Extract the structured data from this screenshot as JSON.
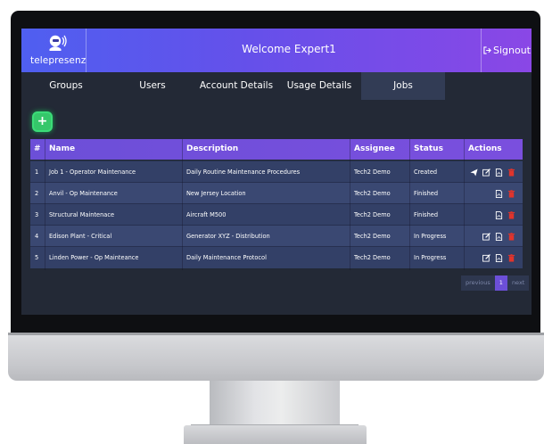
{
  "app": {
    "logo_text": "telepresenz",
    "welcome": "Welcome Expert1",
    "signout_label": "Signout"
  },
  "tabs": [
    {
      "label": "Groups",
      "active": false
    },
    {
      "label": "Users",
      "active": false
    },
    {
      "label": "Account Details",
      "active": false
    },
    {
      "label": "Usage Details",
      "active": false
    },
    {
      "label": "Jobs",
      "active": true
    }
  ],
  "add_button": {
    "label": "+"
  },
  "table": {
    "headers": [
      "#",
      "Name",
      "Description",
      "Assignee",
      "Status",
      "Actions"
    ],
    "rows": [
      {
        "num": "1",
        "name": "Job 1 - Operator Maintenance",
        "description": "Daily Routine Maintenance Procedures",
        "assignee": "Tech2 Demo",
        "status": "Created",
        "actions": [
          "send-icon",
          "edit-icon",
          "pdf-icon",
          "trash-icon"
        ]
      },
      {
        "num": "2",
        "name": "Anvil - Op Maintenance",
        "description": "New Jersey Location",
        "assignee": "Tech2 Demo",
        "status": "Finished",
        "actions": [
          "pdf-icon",
          "trash-icon"
        ]
      },
      {
        "num": "3",
        "name": "Structural Maintenace",
        "description": "Aircraft M500",
        "assignee": "Tech2 Demo",
        "status": "Finished",
        "actions": [
          "pdf-icon",
          "trash-icon"
        ]
      },
      {
        "num": "4",
        "name": "Edison Plant - Critical",
        "description": "Generator XYZ - Distribution",
        "assignee": "Tech2 Demo",
        "status": "In Progress",
        "actions": [
          "edit-icon",
          "pdf-icon",
          "trash-icon"
        ]
      },
      {
        "num": "5",
        "name": "Linden Power - Op Mainteance",
        "description": "Daily Maintenance Protocol",
        "assignee": "Tech2 Demo",
        "status": "In Progress",
        "actions": [
          "edit-icon",
          "pdf-icon",
          "trash-icon"
        ]
      }
    ]
  },
  "pagination": {
    "previous": "previous",
    "current": "1",
    "next": "next"
  },
  "colors": {
    "header_start": "#4f5ff0",
    "header_end": "#8a47e6",
    "table_header": "#6c4fd8",
    "row": "#334067",
    "add_button": "#35c76a",
    "delete_icon": "#e0342c"
  }
}
